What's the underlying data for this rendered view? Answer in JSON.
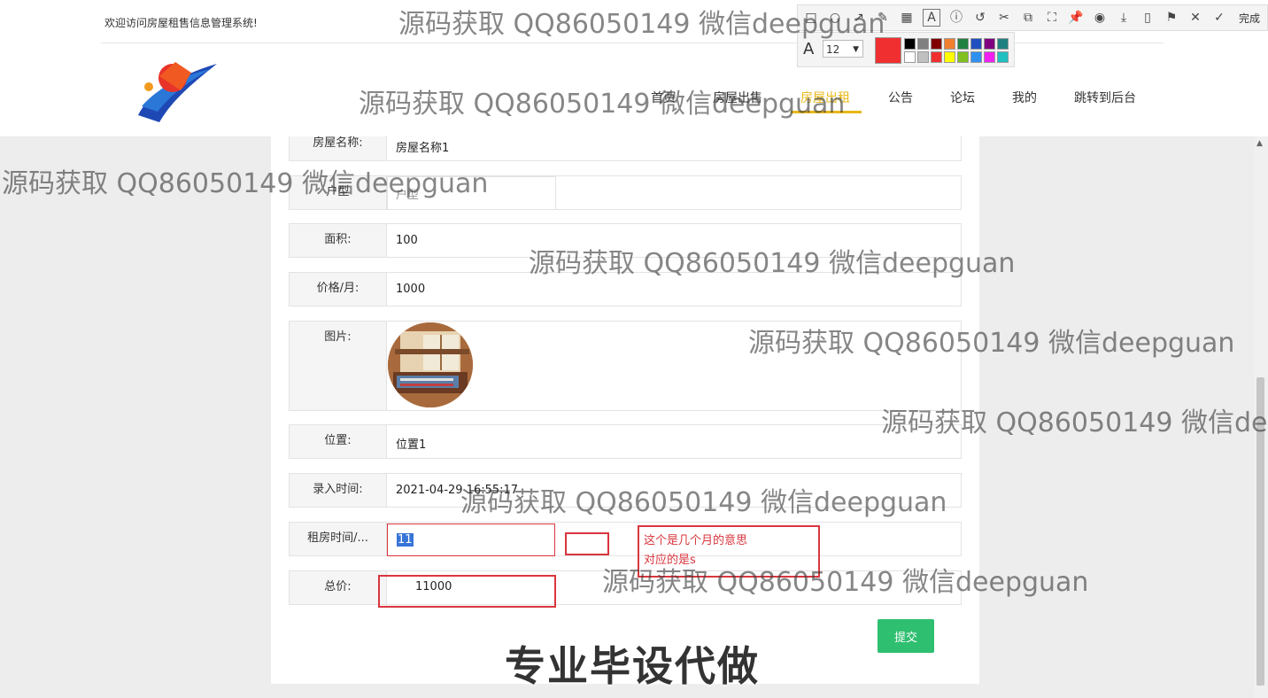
{
  "header": {
    "welcome": "欢迎访问房屋租售信息管理系统!",
    "nav": [
      {
        "label": "首页"
      },
      {
        "label": "房屋出售"
      },
      {
        "label": "房屋出租"
      },
      {
        "label": "公告"
      },
      {
        "label": "论坛"
      },
      {
        "label": "我的"
      },
      {
        "label": "跳转到后台"
      }
    ],
    "active_nav": "房屋出租",
    "accent_color": "#e8b81a"
  },
  "form": {
    "house_name": {
      "label": "房屋名称:",
      "value": "房屋名称1"
    },
    "layout": {
      "label": "户型",
      "value": "户型"
    },
    "area": {
      "label": "面积:",
      "value": "100"
    },
    "price": {
      "label": "价格/月:",
      "value": "1000"
    },
    "image": {
      "label": "图片:"
    },
    "location": {
      "label": "位置:",
      "value": "位置1"
    },
    "created_at": {
      "label": "录入时间:",
      "value": "2021-04-29 16:55:17"
    },
    "rent_duration": {
      "label": "租房时间/...",
      "value": "11"
    },
    "total": {
      "label": "总价:",
      "value": "11000"
    },
    "submit_label": "提交"
  },
  "annotation": {
    "line1": "这个是几个月的意思",
    "line2": "对应的是s",
    "color": "#d9363e"
  },
  "toolbar": {
    "done_label": "完成",
    "font_size": "12",
    "selected_color": "#f03030",
    "icons": [
      "rect-icon",
      "ellipse-icon",
      "arrow-icon",
      "pen-icon",
      "mosaic-icon",
      "text-icon",
      "number-icon",
      "undo-icon",
      "cut-icon",
      "translate-icon",
      "crop-icon",
      "pin-icon",
      "record-icon",
      "download-icon",
      "save-icon",
      "bookmark-icon",
      "close-icon",
      "check-icon"
    ],
    "palette": [
      "#000000",
      "#808080",
      "#800000",
      "#f08030",
      "#208040",
      "#2050c0",
      "#800080",
      "#208080",
      "#ffffff",
      "#c0c0c0",
      "#f03030",
      "#ffff00",
      "#80c020",
      "#3090f0",
      "#f020f0",
      "#20c0c0"
    ]
  },
  "watermark": "源码获取 QQ86050149 微信deepguan",
  "overlay_caption": "专业毕设代做"
}
